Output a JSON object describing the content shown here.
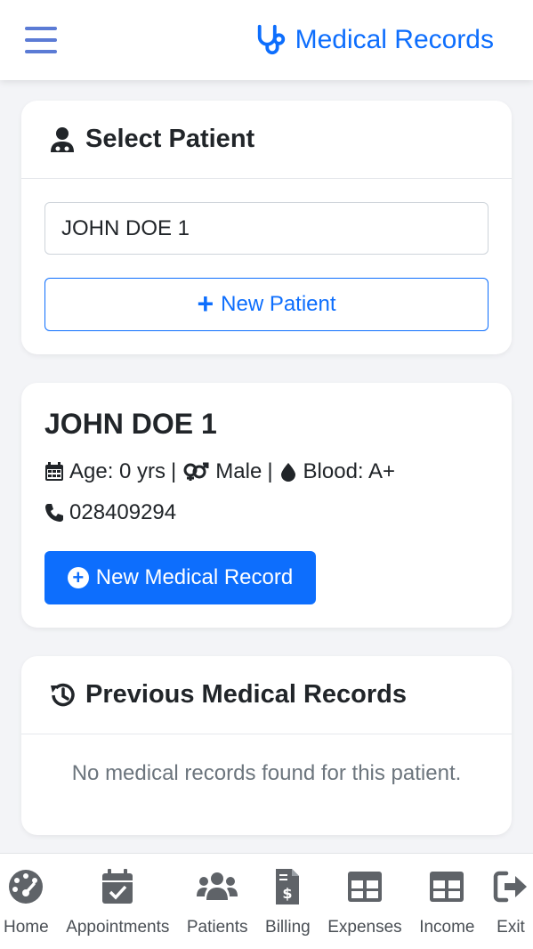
{
  "header": {
    "title": "Medical Records",
    "brand_color": "#0d6efd",
    "menu_icon": "hamburger-icon",
    "brand_icon": "stethoscope-icon"
  },
  "select_patient": {
    "title": "Select Patient",
    "icon": "user-doctor-icon",
    "patient_value": "JOHN DOE 1",
    "new_patient_label": "New Patient"
  },
  "patient": {
    "name": "JOHN DOE 1",
    "age": "Age: 0 yrs",
    "sep1": "|",
    "gender": "Male",
    "sep2": "|",
    "blood": "Blood: A+",
    "phone": "028409294",
    "new_record_label": "New Medical Record"
  },
  "records": {
    "title": "Previous Medical Records",
    "icon": "history-icon",
    "empty_text": "No medical records found for this patient."
  },
  "nav": {
    "items": [
      {
        "label": "Home",
        "icon": "palette-icon"
      },
      {
        "label": "Appointments",
        "icon": "calendar-check-icon"
      },
      {
        "label": "Patients",
        "icon": "users-icon"
      },
      {
        "label": "Billing",
        "icon": "invoice-dollar-icon"
      },
      {
        "label": "Expenses",
        "icon": "table-icon"
      },
      {
        "label": "Income",
        "icon": "table-icon"
      },
      {
        "label": "Exit",
        "icon": "sign-out-icon"
      }
    ]
  }
}
